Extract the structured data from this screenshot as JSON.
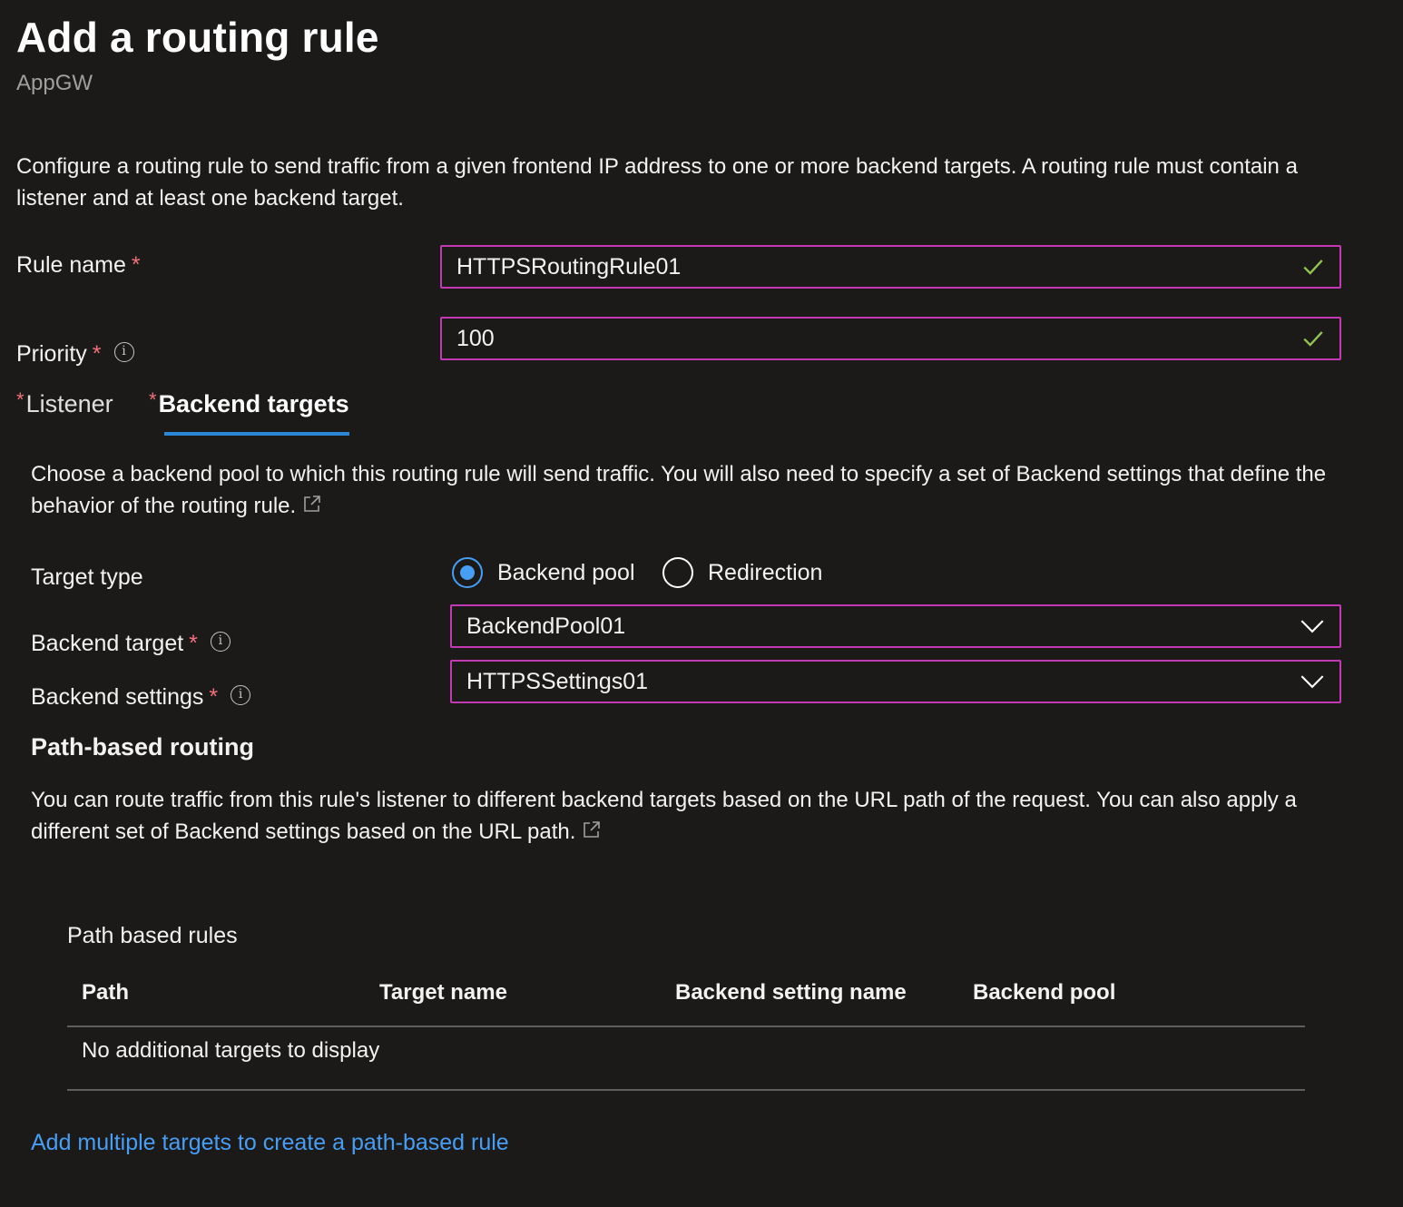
{
  "header": {
    "title": "Add a routing rule",
    "subtitle": "AppGW"
  },
  "intro": "Configure a routing rule to send traffic from a given frontend IP address to one or more backend targets. A routing rule must contain a listener and at least one backend target.",
  "fields": {
    "rule_name": {
      "label": "Rule name",
      "required": "*",
      "value": "HTTPSRoutingRule01"
    },
    "priority": {
      "label": "Priority",
      "required": "*",
      "info": "i",
      "value": "100"
    }
  },
  "tabs": [
    {
      "label": "Listener",
      "required": "*",
      "active": false
    },
    {
      "label": "Backend targets",
      "required": "*",
      "active": true
    }
  ],
  "backend": {
    "description": "Choose a backend pool to which this routing rule will send traffic. You will also need to specify a set of Backend settings that define the behavior of the routing rule.",
    "target_type": {
      "label": "Target type",
      "options": [
        "Backend pool",
        "Redirection"
      ],
      "selected": "Backend pool"
    },
    "backend_target": {
      "label": "Backend target",
      "required": "*",
      "info": "i",
      "value": "BackendPool01"
    },
    "backend_settings": {
      "label": "Backend settings",
      "required": "*",
      "info": "i",
      "value": "HTTPSSettings01"
    }
  },
  "path_routing": {
    "heading": "Path-based routing",
    "description": "You can route traffic from this rule's listener to different backend targets based on the URL path of the request. You can also apply a different set of Backend settings based on the URL path.",
    "table_title": "Path based rules",
    "columns": [
      "Path",
      "Target name",
      "Backend setting name",
      "Backend pool"
    ],
    "empty_text": "No additional targets to display",
    "add_link": "Add multiple targets to create a path-based rule"
  },
  "colors": {
    "background": "#1b1a19",
    "input_border": "#c239b3",
    "accent": "#479ef5",
    "tab_underline": "#2b88d8",
    "required": "#f1707b",
    "valid_check": "#92c353"
  }
}
